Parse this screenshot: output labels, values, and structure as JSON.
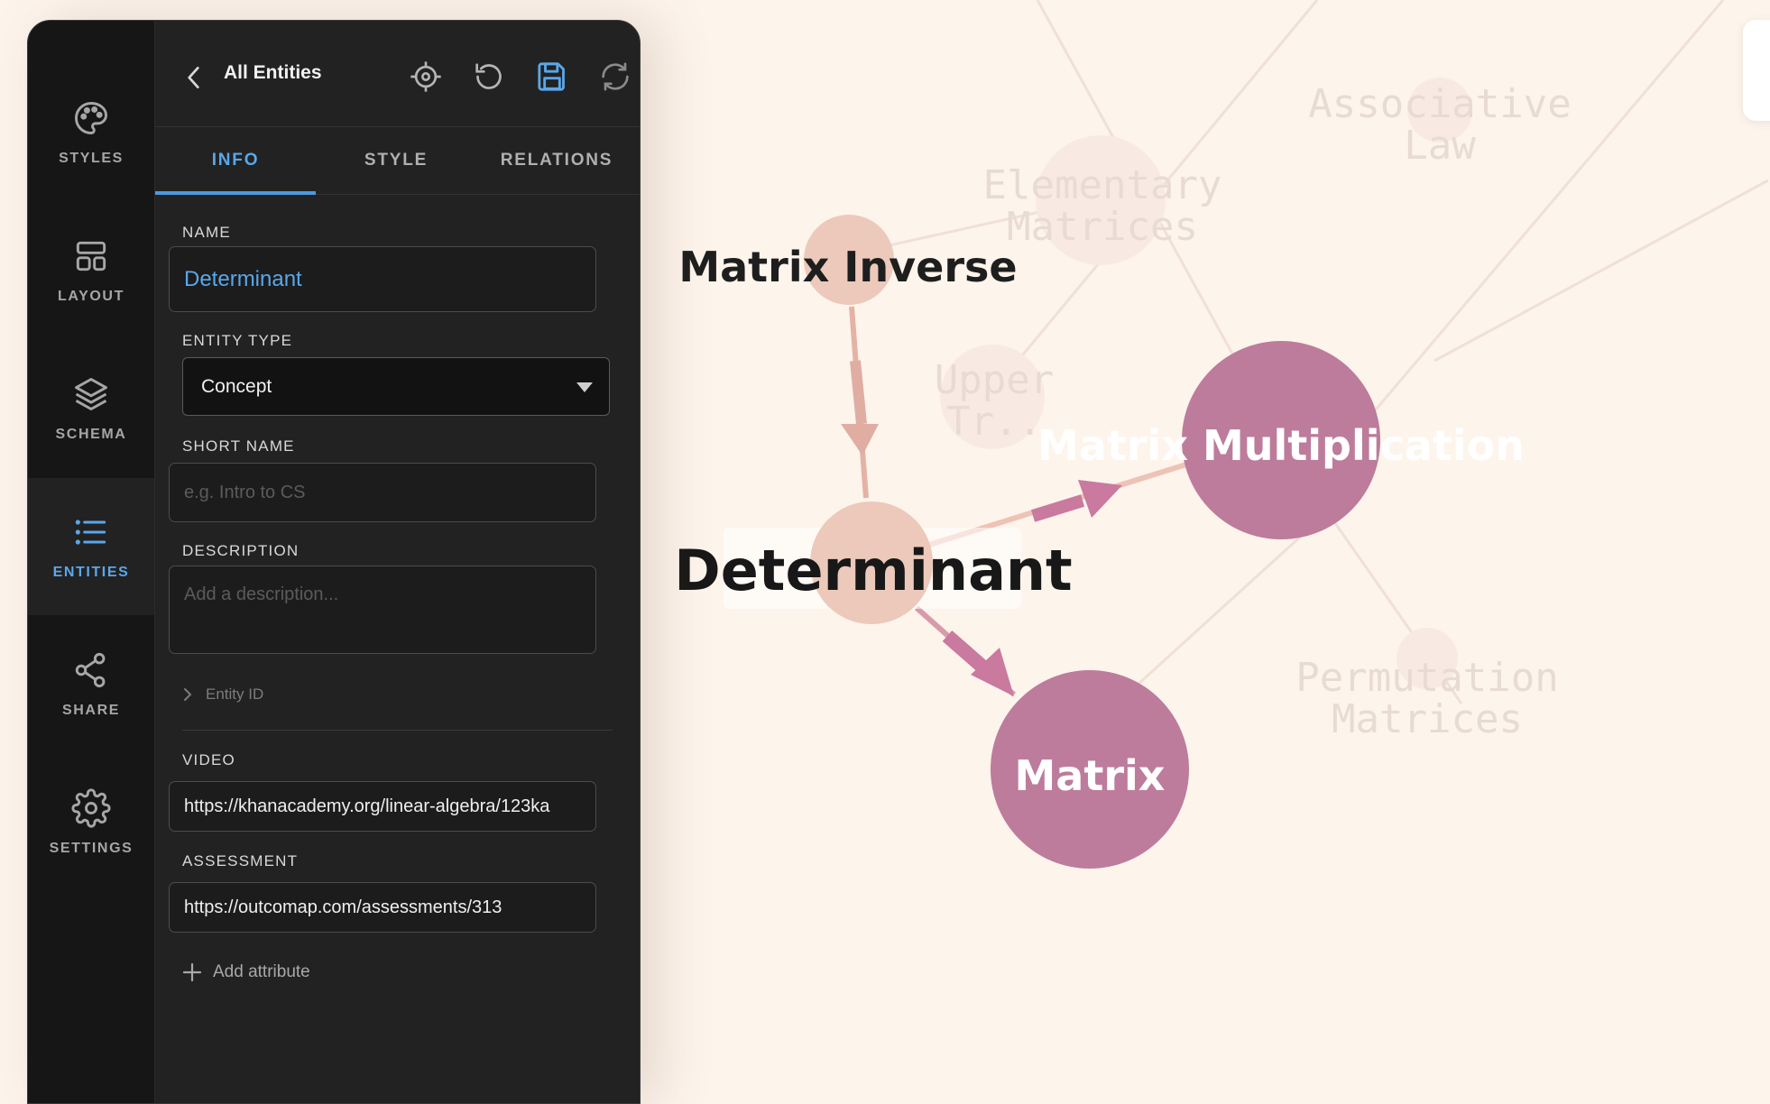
{
  "rail": [
    {
      "key": "styles",
      "label": "STYLES",
      "icon": "palette-icon",
      "active": false
    },
    {
      "key": "layout",
      "label": "LAYOUT",
      "icon": "layout-icon",
      "active": false
    },
    {
      "key": "schema",
      "label": "SCHEMA",
      "icon": "layers-icon",
      "active": false
    },
    {
      "key": "entities",
      "label": "ENTITIES",
      "icon": "list-icon",
      "active": true
    },
    {
      "key": "share",
      "label": "SHARE",
      "icon": "share-icon",
      "active": false
    },
    {
      "key": "settings",
      "label": "SETTINGS",
      "icon": "gear-icon",
      "active": false
    }
  ],
  "header": {
    "title": "All Entities",
    "tools": [
      "crosshair-icon",
      "undo-icon",
      "save-icon",
      "refresh-icon"
    ]
  },
  "tabs": [
    {
      "label": "INFO",
      "active": true
    },
    {
      "label": "STYLE",
      "active": false
    },
    {
      "label": "RELATIONS",
      "active": false
    }
  ],
  "form": {
    "name_label": "NAME",
    "name_value": "Determinant",
    "entity_type_label": "ENTITY TYPE",
    "entity_type_value": "Concept",
    "short_name_label": "SHORT NAME",
    "short_name_placeholder": "e.g. Intro to CS",
    "description_label": "DESCRIPTION",
    "description_placeholder": "Add a description...",
    "entity_id_label": "Entity ID",
    "video_label": "VIDEO",
    "video_value": "https://khanacademy.org/linear-algebra/123ka",
    "assessment_label": "ASSESSMENT",
    "assessment_value": "https://outcomap.com/assessments/313",
    "add_attribute_label": "Add attribute"
  },
  "graph": {
    "nodes": [
      {
        "label": "Associative Law",
        "line1": "Associative",
        "line2": "Law",
        "faded": true
      },
      {
        "label": "Elementary Matrices",
        "line1": "Elementary",
        "line2": "Matrices",
        "faded": true
      },
      {
        "label": "Upper Tr..",
        "line1": "Upper",
        "line2": "Tr..",
        "faded": true
      },
      {
        "label": "Permutation Matrices",
        "line1": "Permutation",
        "line2": "Matrices",
        "faded": true
      },
      {
        "label": "Matrix Inverse",
        "faded": false
      },
      {
        "label": "Determinant",
        "faded": false,
        "selected": true
      },
      {
        "label": "Matrix Multiplication",
        "faded": false
      },
      {
        "label": "Matrix",
        "faded": false
      }
    ],
    "colors": {
      "background": "#fdf4ec",
      "node_primary": "#bd7c9c",
      "node_light": "#e9c4b6",
      "edge_light": "#e5b2a6",
      "edge_primary": "#c97a9e",
      "accent": "#5aa7ea"
    }
  }
}
